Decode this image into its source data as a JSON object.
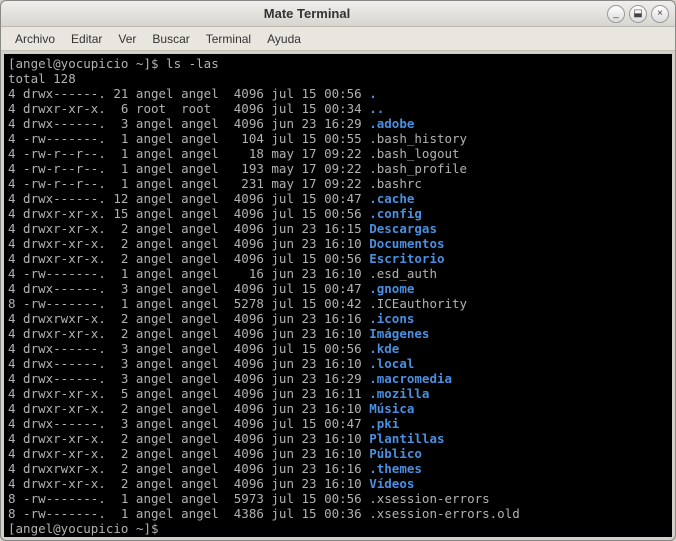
{
  "window": {
    "title": "Mate Terminal",
    "buttons": {
      "min": "_",
      "max": "⬓",
      "close": "×"
    }
  },
  "menubar": [
    "Archivo",
    "Editar",
    "Ver",
    "Buscar",
    "Terminal",
    "Ayuda"
  ],
  "terminal": {
    "prompt_user_host": "[angel@yocupicio ~]$ ",
    "command": "ls -las",
    "total_line": "total 128",
    "rows": [
      {
        "blk": "4",
        "perm": "drwx------.",
        "links": "21",
        "owner": "angel",
        "group": "angel",
        "size": "4096",
        "date": "jul 15 00:56",
        "name": ".",
        "type": "dir"
      },
      {
        "blk": "4",
        "perm": "drwxr-xr-x.",
        "links": "6",
        "owner": "root",
        "group": "root",
        "size": "4096",
        "date": "jul 15 00:34",
        "name": "..",
        "type": "dir"
      },
      {
        "blk": "4",
        "perm": "drwx------.",
        "links": "3",
        "owner": "angel",
        "group": "angel",
        "size": "4096",
        "date": "jun 23 16:29",
        "name": ".adobe",
        "type": "dir"
      },
      {
        "blk": "4",
        "perm": "-rw-------.",
        "links": "1",
        "owner": "angel",
        "group": "angel",
        "size": "104",
        "date": "jul 15 00:55",
        "name": ".bash_history",
        "type": "file"
      },
      {
        "blk": "4",
        "perm": "-rw-r--r--.",
        "links": "1",
        "owner": "angel",
        "group": "angel",
        "size": "18",
        "date": "may 17 09:22",
        "name": ".bash_logout",
        "type": "file"
      },
      {
        "blk": "4",
        "perm": "-rw-r--r--.",
        "links": "1",
        "owner": "angel",
        "group": "angel",
        "size": "193",
        "date": "may 17 09:22",
        "name": ".bash_profile",
        "type": "file"
      },
      {
        "blk": "4",
        "perm": "-rw-r--r--.",
        "links": "1",
        "owner": "angel",
        "group": "angel",
        "size": "231",
        "date": "may 17 09:22",
        "name": ".bashrc",
        "type": "file"
      },
      {
        "blk": "4",
        "perm": "drwx------.",
        "links": "12",
        "owner": "angel",
        "group": "angel",
        "size": "4096",
        "date": "jul 15 00:47",
        "name": ".cache",
        "type": "dir"
      },
      {
        "blk": "4",
        "perm": "drwxr-xr-x.",
        "links": "15",
        "owner": "angel",
        "group": "angel",
        "size": "4096",
        "date": "jul 15 00:56",
        "name": ".config",
        "type": "dir"
      },
      {
        "blk": "4",
        "perm": "drwxr-xr-x.",
        "links": "2",
        "owner": "angel",
        "group": "angel",
        "size": "4096",
        "date": "jun 23 16:15",
        "name": "Descargas",
        "type": "dir"
      },
      {
        "blk": "4",
        "perm": "drwxr-xr-x.",
        "links": "2",
        "owner": "angel",
        "group": "angel",
        "size": "4096",
        "date": "jun 23 16:10",
        "name": "Documentos",
        "type": "dir"
      },
      {
        "blk": "4",
        "perm": "drwxr-xr-x.",
        "links": "2",
        "owner": "angel",
        "group": "angel",
        "size": "4096",
        "date": "jul 15 00:56",
        "name": "Escritorio",
        "type": "dir"
      },
      {
        "blk": "4",
        "perm": "-rw-------.",
        "links": "1",
        "owner": "angel",
        "group": "angel",
        "size": "16",
        "date": "jun 23 16:10",
        "name": ".esd_auth",
        "type": "file"
      },
      {
        "blk": "4",
        "perm": "drwx------.",
        "links": "3",
        "owner": "angel",
        "group": "angel",
        "size": "4096",
        "date": "jul 15 00:47",
        "name": ".gnome",
        "type": "dir"
      },
      {
        "blk": "8",
        "perm": "-rw-------.",
        "links": "1",
        "owner": "angel",
        "group": "angel",
        "size": "5278",
        "date": "jul 15 00:42",
        "name": ".ICEauthority",
        "type": "file"
      },
      {
        "blk": "4",
        "perm": "drwxrwxr-x.",
        "links": "2",
        "owner": "angel",
        "group": "angel",
        "size": "4096",
        "date": "jun 23 16:16",
        "name": ".icons",
        "type": "dir"
      },
      {
        "blk": "4",
        "perm": "drwxr-xr-x.",
        "links": "2",
        "owner": "angel",
        "group": "angel",
        "size": "4096",
        "date": "jun 23 16:10",
        "name": "Imágenes",
        "type": "dir"
      },
      {
        "blk": "4",
        "perm": "drwx------.",
        "links": "3",
        "owner": "angel",
        "group": "angel",
        "size": "4096",
        "date": "jul 15 00:56",
        "name": ".kde",
        "type": "dir"
      },
      {
        "blk": "4",
        "perm": "drwx------.",
        "links": "3",
        "owner": "angel",
        "group": "angel",
        "size": "4096",
        "date": "jun 23 16:10",
        "name": ".local",
        "type": "dir"
      },
      {
        "blk": "4",
        "perm": "drwx------.",
        "links": "3",
        "owner": "angel",
        "group": "angel",
        "size": "4096",
        "date": "jun 23 16:29",
        "name": ".macromedia",
        "type": "dir"
      },
      {
        "blk": "4",
        "perm": "drwxr-xr-x.",
        "links": "5",
        "owner": "angel",
        "group": "angel",
        "size": "4096",
        "date": "jun 23 16:11",
        "name": ".mozilla",
        "type": "dir"
      },
      {
        "blk": "4",
        "perm": "drwxr-xr-x.",
        "links": "2",
        "owner": "angel",
        "group": "angel",
        "size": "4096",
        "date": "jun 23 16:10",
        "name": "Música",
        "type": "dir"
      },
      {
        "blk": "4",
        "perm": "drwx------.",
        "links": "3",
        "owner": "angel",
        "group": "angel",
        "size": "4096",
        "date": "jul 15 00:47",
        "name": ".pki",
        "type": "dir"
      },
      {
        "blk": "4",
        "perm": "drwxr-xr-x.",
        "links": "2",
        "owner": "angel",
        "group": "angel",
        "size": "4096",
        "date": "jun 23 16:10",
        "name": "Plantillas",
        "type": "dir"
      },
      {
        "blk": "4",
        "perm": "drwxr-xr-x.",
        "links": "2",
        "owner": "angel",
        "group": "angel",
        "size": "4096",
        "date": "jun 23 16:10",
        "name": "Público",
        "type": "dir"
      },
      {
        "blk": "4",
        "perm": "drwxrwxr-x.",
        "links": "2",
        "owner": "angel",
        "group": "angel",
        "size": "4096",
        "date": "jun 23 16:16",
        "name": ".themes",
        "type": "dir"
      },
      {
        "blk": "4",
        "perm": "drwxr-xr-x.",
        "links": "2",
        "owner": "angel",
        "group": "angel",
        "size": "4096",
        "date": "jun 23 16:10",
        "name": "Vídeos",
        "type": "dir"
      },
      {
        "blk": "8",
        "perm": "-rw-------.",
        "links": "1",
        "owner": "angel",
        "group": "angel",
        "size": "5973",
        "date": "jul 15 00:56",
        "name": ".xsession-errors",
        "type": "file"
      },
      {
        "blk": "8",
        "perm": "-rw-------.",
        "links": "1",
        "owner": "angel",
        "group": "angel",
        "size": "4386",
        "date": "jul 15 00:36",
        "name": ".xsession-errors.old",
        "type": "file"
      }
    ],
    "prompt_tail": "[angel@yocupicio ~]$ "
  }
}
